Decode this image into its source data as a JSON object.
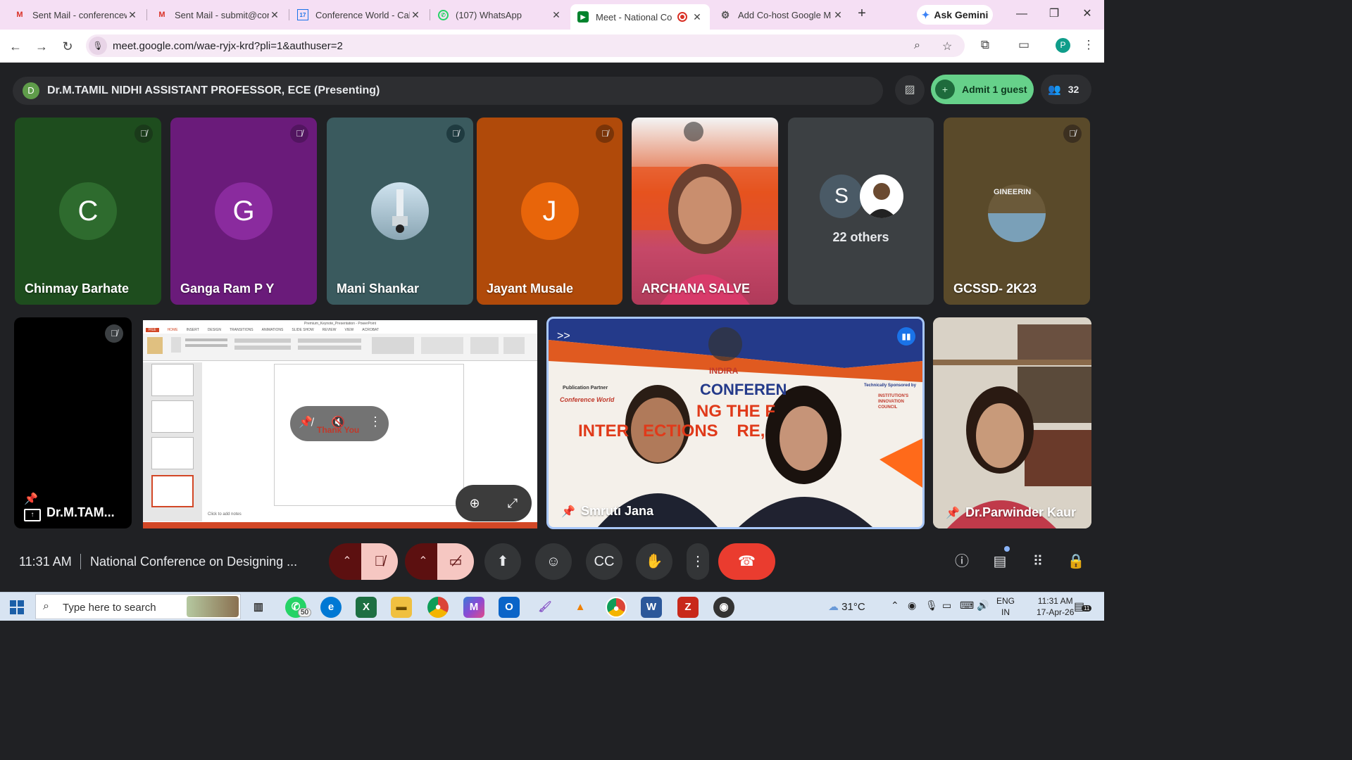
{
  "browser": {
    "tabs": [
      {
        "label": "Sent Mail - conferencew",
        "icon": "gmail-icon"
      },
      {
        "label": "Sent Mail - submit@con",
        "icon": "gmail-icon"
      },
      {
        "label": "Conference World - Cal",
        "icon": "calendar-icon",
        "fav_text": "17"
      },
      {
        "label": "(107) WhatsApp",
        "icon": "whatsapp-icon"
      },
      {
        "label": "Meet - National Co",
        "icon": "meet-icon"
      },
      {
        "label": "Add Co-host Google M",
        "icon": "chrome-icon"
      }
    ],
    "new_tab": "+",
    "gemini_label": "Ask Gemini",
    "url": "meet.google.com/wae-ryjx-krd?pli=1&authuser=2",
    "profile_initial": "P"
  },
  "meet": {
    "presenter_initial": "D",
    "presenter_text": "Dr.M.TAMIL NIDHI ASSISTANT PROFESSOR, ECE (Presenting)",
    "admit_label": "Admit 1 guest",
    "participant_count": "32",
    "tiles": [
      {
        "name": "Chinmay Barhate",
        "initial": "C",
        "bg": "#1e4d1e",
        "avatar": "#2e6b2e"
      },
      {
        "name": "Ganga Ram P Y",
        "initial": "G",
        "bg": "#6a1b7a",
        "avatar": "#8a2b9e"
      },
      {
        "name": "Mani Shankar",
        "bg": "#3a5a5e"
      },
      {
        "name": "Jayant Musale",
        "initial": "J",
        "bg": "#b04a0a",
        "avatar": "#e8650a"
      },
      {
        "name": "ARCHANA SALVE",
        "bg": "#c64868"
      },
      {
        "others_label": "22 others",
        "initial": "S"
      },
      {
        "name": "GCSSD- 2K23",
        "bg": "#5a4a2a"
      },
      {
        "name": "Dr.M.TAM..."
      },
      {
        "name": "Smruti Jana"
      },
      {
        "name": "Dr.Parwinder Kaur"
      }
    ],
    "slide": {
      "file_title": "Premium_Keynote_Presentation - PowerPoint",
      "thumb_text": "Thank You",
      "notes": "Click to add notes"
    },
    "banner": {
      "org": "INDIRA",
      "line1": "CONFEREN",
      "line2": "NG THE F",
      "line3": "INTER   ECTIONS    RE,",
      "partner_label": "Publication Partner",
      "partner": "Conference World",
      "sponsor_label": "Technically Sponsored by",
      "sponsor": "INSTITUTION'S INNOVATION COUNCIL"
    },
    "clock": "11:31 AM",
    "meeting_name": "National Conference on Designing ..."
  },
  "taskbar": {
    "search_placeholder": "Type here to search",
    "whatsapp_badge": "50",
    "temperature": "31°C",
    "lang1": "ENG",
    "lang2": "IN",
    "time": "11:31 AM",
    "date": "17-Apr-26",
    "notif_count": "11"
  },
  "colors": {
    "meet_bg": "#202124",
    "admit_green": "#66d18a",
    "leave_red": "#ea3c2f",
    "tab_strip": "#f5dff4"
  }
}
